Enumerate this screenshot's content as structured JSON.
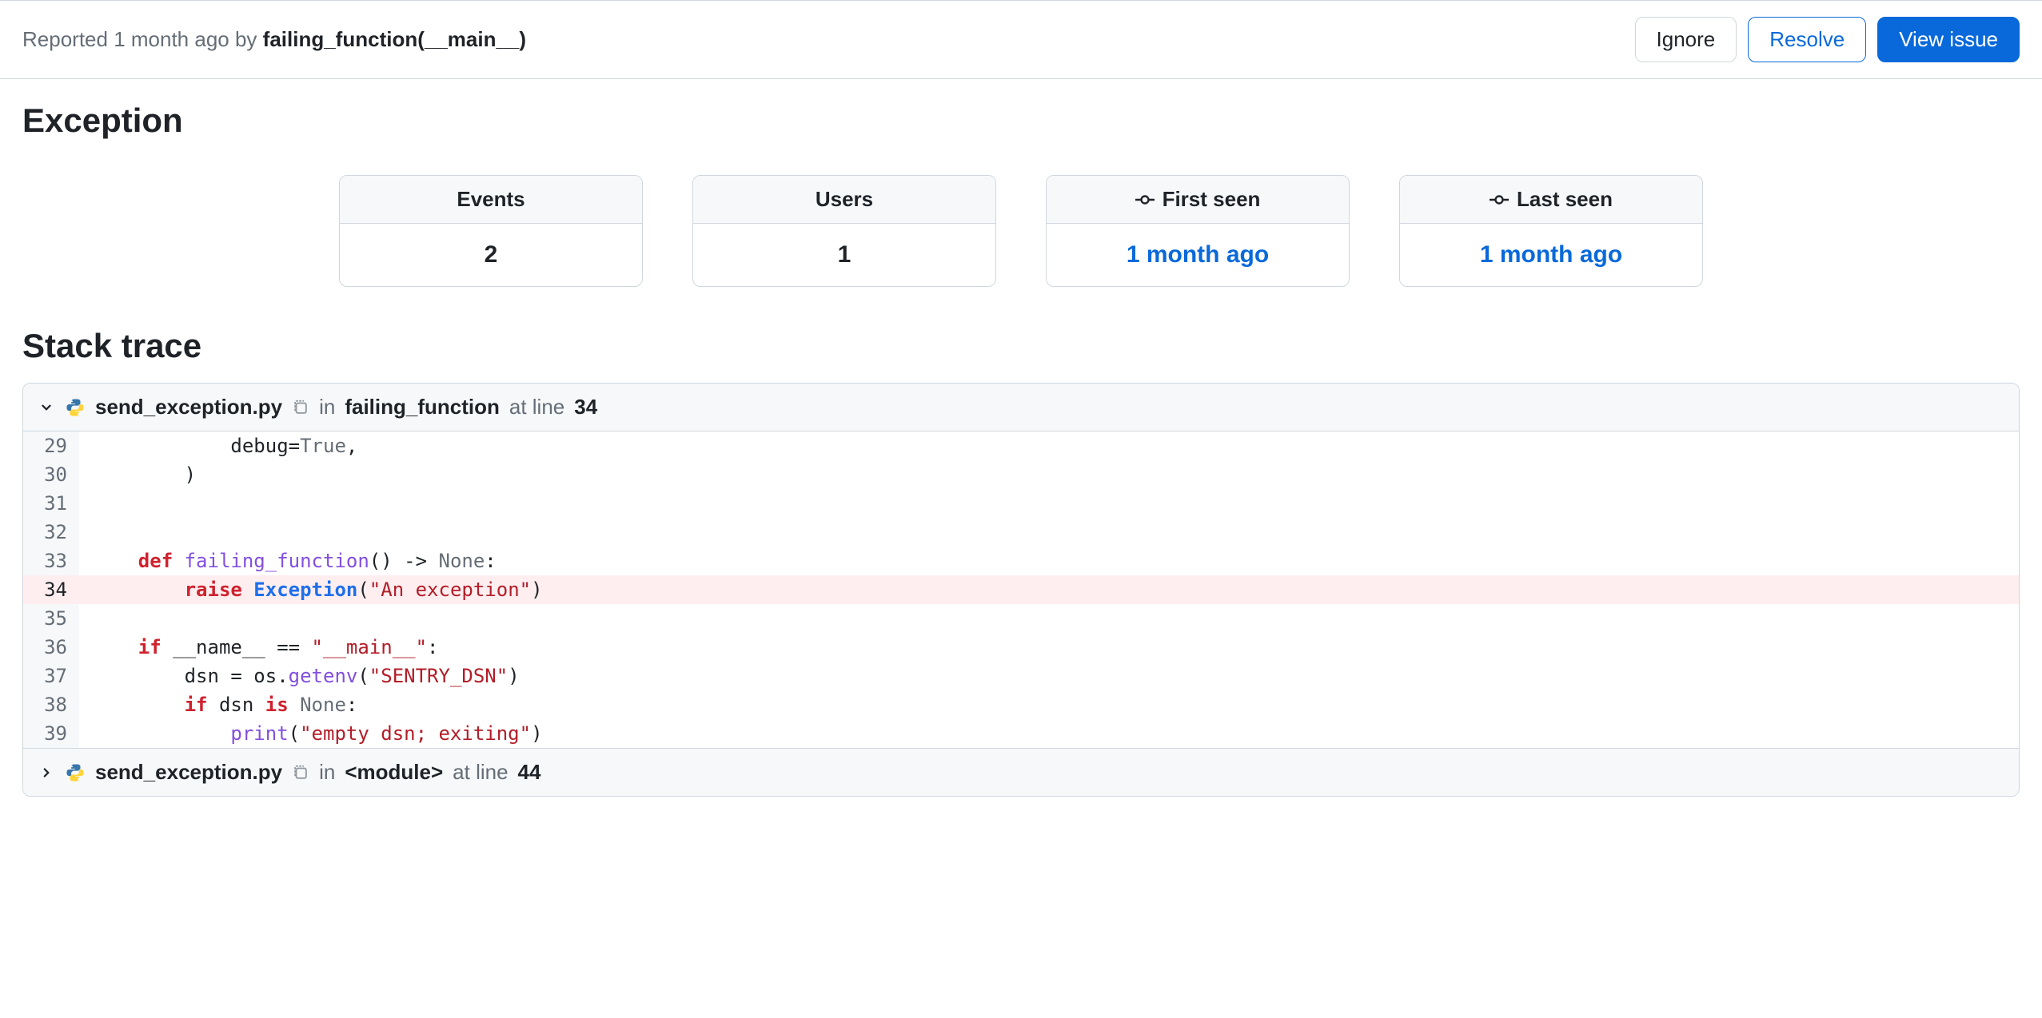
{
  "header": {
    "reported_prefix": "Reported ",
    "reported_time": "1 month ago",
    "reported_by": " by ",
    "reported_source": "failing_function(__main__)"
  },
  "actions": {
    "ignore": "Ignore",
    "resolve": "Resolve",
    "view": "View issue"
  },
  "titles": {
    "exception": "Exception",
    "stack": "Stack trace"
  },
  "stats": {
    "events_label": "Events",
    "events_value": "2",
    "users_label": "Users",
    "users_value": "1",
    "first_label": "First seen",
    "first_value": "1 month ago",
    "last_label": "Last seen",
    "last_value": "1 month ago"
  },
  "frame0": {
    "file": "send_exception.py",
    "in": "in",
    "func": "failing_function",
    "at": "at line",
    "line": "34"
  },
  "frame1": {
    "file": "send_exception.py",
    "in": "in",
    "func": "<module>",
    "at": "at line",
    "line": "44"
  },
  "code": {
    "l29": "29",
    "c29a": "            debug=",
    "c29b": "True",
    "c29c": ",",
    "l30": "30",
    "c30": "        )",
    "l31": "31",
    "c31": "",
    "l32": "32",
    "c32": "",
    "l33": "33",
    "c33a": "    ",
    "c33b": "def",
    "c33c": " ",
    "c33d": "failing_function",
    "c33e": "() -> ",
    "c33f": "None",
    "c33g": ":",
    "l34": "34",
    "c34a": "        ",
    "c34b": "raise",
    "c34c": " ",
    "c34d": "Exception",
    "c34e": "(",
    "c34f": "\"An exception\"",
    "c34g": ")",
    "l35": "35",
    "c35": "",
    "l36": "36",
    "c36a": "    ",
    "c36b": "if",
    "c36c": " __name__ == ",
    "c36d": "\"__main__\"",
    "c36e": ":",
    "l37": "37",
    "c37a": "        dsn = os.",
    "c37b": "getenv",
    "c37c": "(",
    "c37d": "\"SENTRY_DSN\"",
    "c37e": ")",
    "l38": "38",
    "c38a": "        ",
    "c38b": "if",
    "c38c": " dsn ",
    "c38d": "is",
    "c38e": " ",
    "c38f": "None",
    "c38g": ":",
    "l39": "39",
    "c39a": "            ",
    "c39b": "print",
    "c39c": "(",
    "c39d": "\"empty dsn; exiting\"",
    "c39e": ")"
  }
}
